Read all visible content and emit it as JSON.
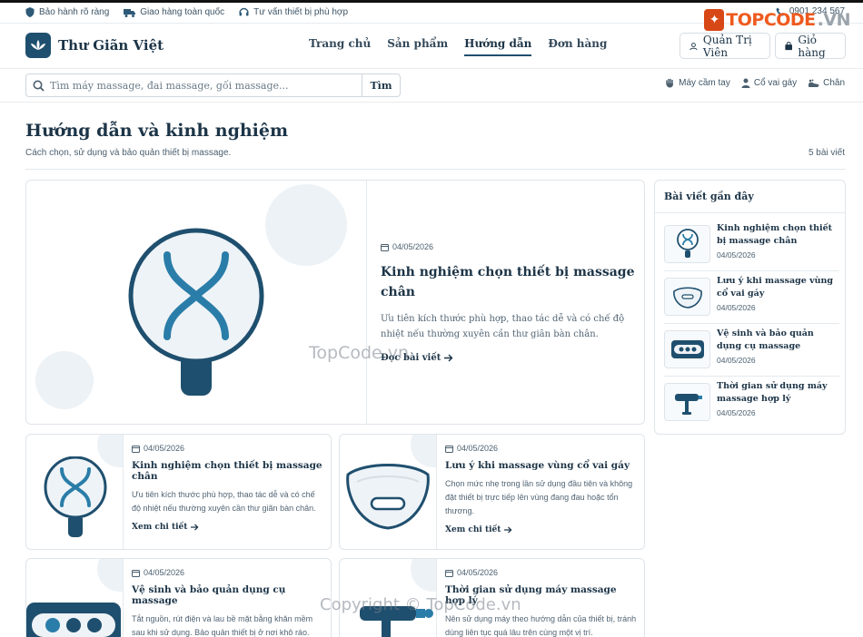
{
  "topbar": {
    "items": [
      {
        "icon": "shield-icon",
        "label": "Bảo hành rõ ràng"
      },
      {
        "icon": "truck-icon",
        "label": "Giao hàng toàn quốc"
      },
      {
        "icon": "headset-icon",
        "label": "Tư vấn thiết bị phù hợp"
      }
    ],
    "phone": "0901 234 567",
    "logo_text": "TOPCODE",
    "logo_suffix": ".VN"
  },
  "header": {
    "brand": "Thư Giãn Việt",
    "nav": [
      {
        "label": "Trang chủ",
        "active": false
      },
      {
        "label": "Sản phẩm",
        "active": false
      },
      {
        "label": "Hướng dẫn",
        "active": true
      },
      {
        "label": "Đơn hàng",
        "active": false
      }
    ],
    "admin_label": "Quản Trị Viên",
    "cart_label": "Giỏ hàng"
  },
  "search": {
    "placeholder": "Tìm máy massage, đai massage, gối massage...",
    "button": "Tìm",
    "quick_links": [
      {
        "icon": "hand-icon",
        "label": "Máy cầm tay"
      },
      {
        "icon": "person-icon",
        "label": "Cổ vai gáy"
      },
      {
        "icon": "foot-icon",
        "label": "Chân"
      }
    ]
  },
  "page": {
    "title": "Hướng dẫn và kinh nghiệm",
    "subtitle": "Cách chọn, sử dụng và bảo quản thiết bị massage.",
    "count": "5 bài viết"
  },
  "featured": {
    "date": "04/05/2026",
    "title": "Kinh nghiệm chọn thiết bị massage chân",
    "desc": "Ưu tiên kích thước phù hợp, thao tác dễ và có chế độ nhiệt nếu thường xuyên cần thư giãn bàn chân.",
    "read_more": "Đọc bài viết"
  },
  "articles": [
    {
      "date": "04/05/2026",
      "title": "Kinh nghiệm chọn thiết bị massage chân",
      "desc": "Ưu tiên kích thước phù hợp, thao tác dễ và có chế độ nhiệt nếu thường xuyên cần thư giãn bàn chân.",
      "read_more": "Xem chi tiết"
    },
    {
      "date": "04/05/2026",
      "title": "Lưu ý khi massage vùng cổ vai gáy",
      "desc": "Chọn mức nhẹ trong lần sử dụng đầu tiên và không đặt thiết bị trực tiếp lên vùng đang đau hoặc tổn thương.",
      "read_more": "Xem chi tiết"
    },
    {
      "date": "04/05/2026",
      "title": "Vệ sinh và bảo quản dụng cụ massage",
      "desc": "Tắt nguồn, rút điện và lau bề mặt bằng khăn mềm sau khi sử dụng. Bảo quản thiết bị ở nơi khô ráo."
    },
    {
      "date": "04/05/2026",
      "title": "Thời gian sử dụng máy massage hợp lý",
      "desc": "Nên sử dụng máy theo hướng dẫn của thiết bị, tránh dùng liên tục quá lâu trên cùng một vị trí."
    }
  ],
  "sidebar": {
    "title": "Bài viết gần đây",
    "items": [
      {
        "title": "Kinh nghiệm chọn thiết bị massage chân",
        "date": "04/05/2026"
      },
      {
        "title": "Lưu ý khi massage vùng cổ vai gáy",
        "date": "04/05/2026"
      },
      {
        "title": "Vệ sinh và bảo quản dụng cụ massage",
        "date": "04/05/2026"
      },
      {
        "title": "Thời gian sử dụng máy massage hợp lý",
        "date": "04/05/2026"
      }
    ]
  },
  "watermarks": {
    "center": "TopCode.vn",
    "bottom": "Copyright © TopCode.vn"
  },
  "colors": {
    "primary": "#1f4f6e",
    "text": "#1c3447",
    "accent_logo": "#ef5a1e"
  }
}
